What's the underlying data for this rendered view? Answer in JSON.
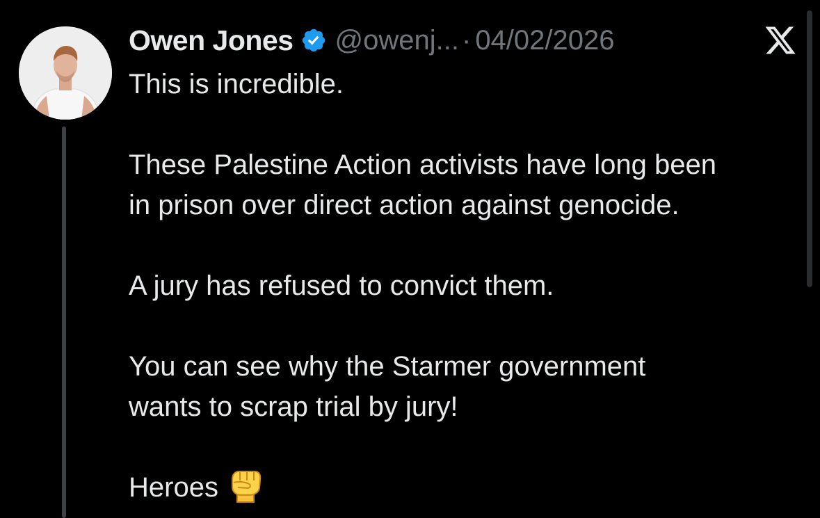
{
  "tweet": {
    "author_name": "Owen Jones",
    "handle": "@owenj...",
    "separator": "·",
    "date": "04/02/2026",
    "paragraphs": {
      "p1": "This is incredible.",
      "p2_line1": "These Palestine Action activists have long been",
      "p2_line2": "in prison over direct action against genocide.",
      "p3": "A jury has refused to convict them.",
      "p4_line1": "You can see why the Starmer government",
      "p4_line2": "wants to scrap trial by jury!",
      "p5": "Heroes"
    }
  },
  "icons": {
    "verified": "verified-badge-icon",
    "platform": "x-logo-icon",
    "emoji": "raised-fist-emoji"
  },
  "colors": {
    "background": "#000000",
    "text": "#e7e9ea",
    "secondary_text": "#71767b",
    "verified_blue": "#1d9bf0",
    "thread_line": "#3e4144"
  }
}
